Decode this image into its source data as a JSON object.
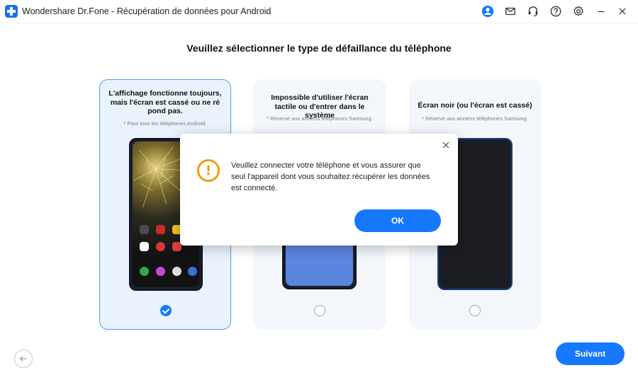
{
  "window": {
    "title": "Wondershare Dr.Fone - Récupération de données pour Android",
    "icons": [
      "account-icon",
      "mail-icon",
      "headset-icon",
      "help-icon",
      "settings-icon",
      "minimize-icon",
      "close-icon"
    ]
  },
  "main": {
    "heading": "Veuillez sélectionner le type de défaillance du téléphone",
    "cards": [
      {
        "title": "L'affichage fonctionne toujours, mais l'écran est cassé ou ne ré pond pas.",
        "note": "* Pour tous les téléphones Android.",
        "selected": true
      },
      {
        "title": "Impossible d'utiliser l'écran tactile ou d'entrer dans le système",
        "note": "* Réservé aux anciens téléphones Samsung.",
        "selected": false
      },
      {
        "title": "Écran noir (ou l'écran est cassé)",
        "note": "* Réservé aux anciens téléphones Samsung.",
        "selected": false
      }
    ]
  },
  "dialog": {
    "message": "Veuillez connecter votre téléphone et vous assurer que seul l'appareil dont vous souhaitez récupérer les données est connecté.",
    "ok_label": "OK",
    "icon": "warning-icon"
  },
  "footer": {
    "back_icon": "arrow-left-icon",
    "next_label": "Suivant"
  },
  "colors": {
    "accent": "#1677ff",
    "warning": "#f39a12",
    "card_bg": "#f3f7fc",
    "selected_border": "#4a9cf0"
  }
}
